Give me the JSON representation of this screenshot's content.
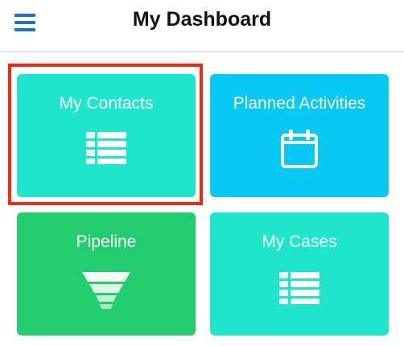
{
  "header": {
    "title": "My Dashboard",
    "menu_icon": "hamburger-menu-icon"
  },
  "tiles": [
    {
      "label": "My Contacts",
      "icon": "list-icon",
      "color": "#1ee6cc",
      "highlighted": true
    },
    {
      "label": "Planned Activities",
      "icon": "calendar-icon",
      "color": "#08c9f4"
    },
    {
      "label": "Pipeline",
      "icon": "funnel-icon",
      "color": "#22cc6f"
    },
    {
      "label": "My Cases",
      "icon": "list-icon",
      "color": "#1ee6cc"
    }
  ],
  "colors": {
    "accent": "#1f73c7",
    "highlight": "#f02a12"
  }
}
